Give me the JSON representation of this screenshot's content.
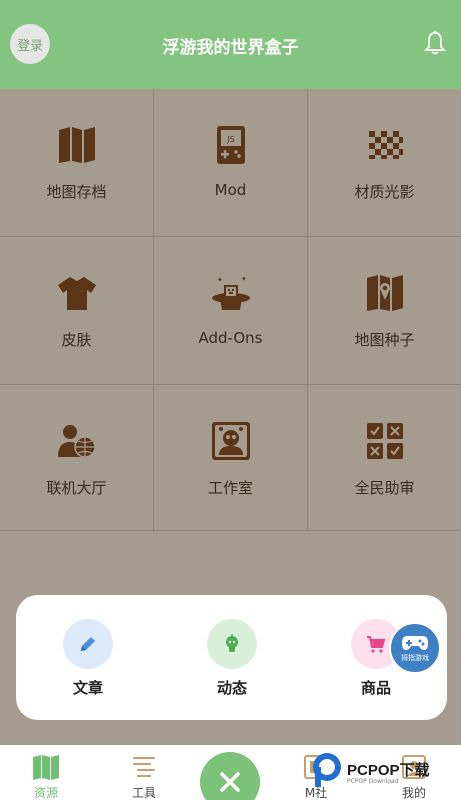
{
  "header": {
    "title": "浮游我的世界盒子",
    "login_label": "登录",
    "bell_icon": "bell-icon"
  },
  "grid": {
    "items": [
      {
        "label": "地图存档",
        "icon": "map-icon"
      },
      {
        "label": "Mod",
        "icon": "game-console-icon"
      },
      {
        "label": "材质光影",
        "icon": "checkerboard-icon"
      },
      {
        "label": "皮肤",
        "icon": "shirt-icon"
      },
      {
        "label": "Add-Ons",
        "icon": "magic-hat-icon"
      },
      {
        "label": "地图种子",
        "icon": "map-pin-icon"
      },
      {
        "label": "联机大厅",
        "icon": "multiplayer-icon"
      },
      {
        "label": "工作室",
        "icon": "studio-icon"
      },
      {
        "label": "全民助审",
        "icon": "review-icon"
      }
    ]
  },
  "popup": {
    "items": [
      {
        "label": "文章",
        "icon": "pencil-icon",
        "color": "#dbe9f8"
      },
      {
        "label": "动态",
        "icon": "bulb-icon",
        "color": "#d9efd9"
      },
      {
        "label": "商品",
        "icon": "cart-icon",
        "color": "#fbe0ec"
      }
    ]
  },
  "float_game": {
    "label": "拇指游戏"
  },
  "tabbar": {
    "items": [
      {
        "label": "资源",
        "icon": "map-icon",
        "active": true
      },
      {
        "label": "工具",
        "icon": "tools-icon",
        "active": false
      },
      {
        "label": "M社",
        "icon": "community-icon",
        "active": false
      },
      {
        "label": "我的",
        "icon": "profile-icon",
        "active": false
      }
    ],
    "center_icon": "close-icon"
  },
  "watermark": {
    "text": "PCPOP下载",
    "sub": "PCPOP Download"
  },
  "colors": {
    "header": "#83c481",
    "background": "#a59b8e",
    "icon_brown": "#5a3518",
    "accent_green": "#7cc27a"
  }
}
